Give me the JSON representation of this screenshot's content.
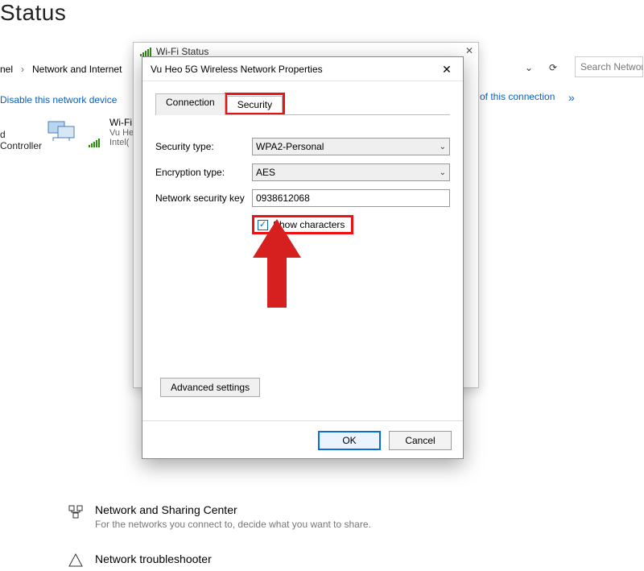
{
  "page_title_fragment": "Status",
  "breadcrumb": {
    "items": [
      "nel",
      "Network and Internet"
    ]
  },
  "toolbar": {
    "search_placeholder": "Search Network"
  },
  "action_bar": {
    "disable_link": "Disable this network device",
    "status_link_fragment": "us of this connection"
  },
  "left_fragment": {
    "line1": "d",
    "line2": "Controller"
  },
  "adapter": {
    "name": "Wi-Fi",
    "ssid_fragment": "Vu He",
    "driver_fragment": "Intel("
  },
  "wifi_status_win": {
    "title": "Wi-Fi Status"
  },
  "props": {
    "title": "Vu Heo 5G Wireless Network Properties",
    "tabs": {
      "connection": "Connection",
      "security": "Security"
    },
    "labels": {
      "security_type": "Security type:",
      "encryption_type": "Encryption type:",
      "key": "Network security key"
    },
    "values": {
      "security_type": "WPA2-Personal",
      "encryption_type": "AES",
      "key": "0938612068"
    },
    "show_chars_label": "Show characters",
    "advanced_btn": "Advanced settings",
    "ok": "OK",
    "cancel": "Cancel"
  },
  "bottom": {
    "nsc_title": "Network and Sharing Center",
    "nsc_sub": "For the networks you connect to, decide what you want to share.",
    "trouble_title": "Network troubleshooter"
  }
}
